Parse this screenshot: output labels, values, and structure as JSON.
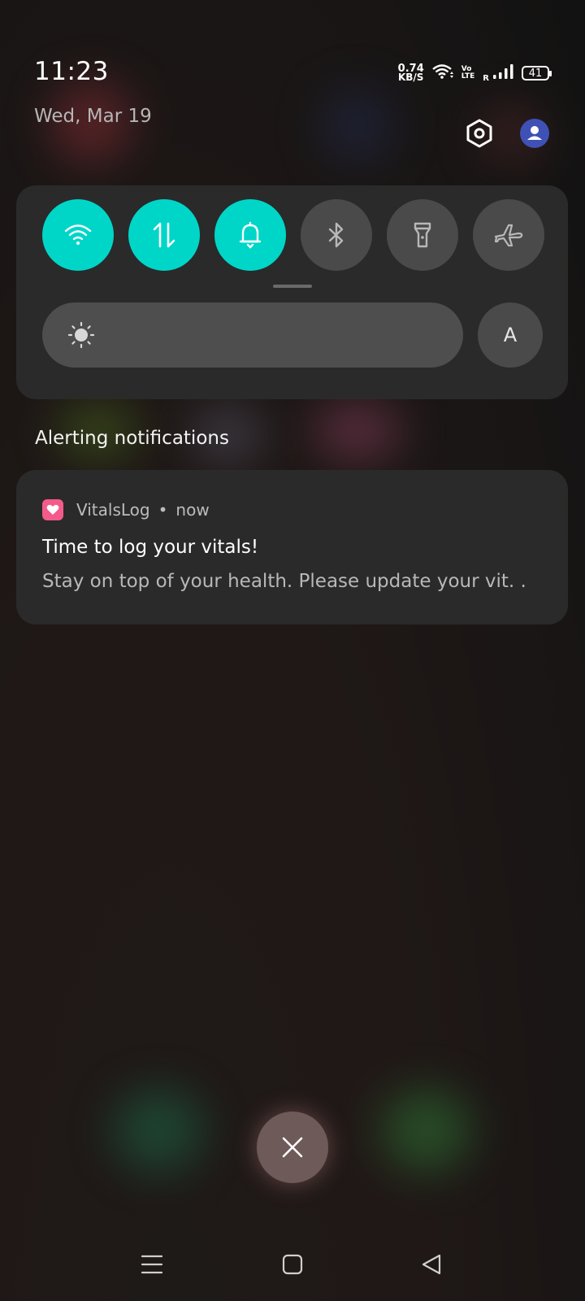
{
  "status_bar": {
    "time": "11:23",
    "net_speed_value": "0.74",
    "net_speed_unit": "KB/S",
    "volte_top": "Vo",
    "volte_bottom": "LTE",
    "roaming": "R",
    "battery": "41"
  },
  "header": {
    "date": "Wed, Mar 19",
    "icons": [
      "settings-icon",
      "account-icon"
    ]
  },
  "quick_settings": {
    "tiles": [
      {
        "name": "wifi",
        "active": true
      },
      {
        "name": "mobile-data",
        "active": true
      },
      {
        "name": "sound",
        "active": true
      },
      {
        "name": "bluetooth",
        "active": false
      },
      {
        "name": "flashlight",
        "active": false
      },
      {
        "name": "airplane-mode",
        "active": false
      }
    ],
    "auto_brightness_label": "A",
    "accent_color": "#00d6c8"
  },
  "notifications": {
    "section_title": "Alerting notifications",
    "items": [
      {
        "app_name": "VitalsLog",
        "separator": "•",
        "time": "now",
        "title": "Time to log your vitals!",
        "text": "Stay on top of your health. Please update your vit. ."
      }
    ]
  },
  "actions": {
    "clear_all": "close-icon"
  },
  "nav_bar": {
    "buttons": [
      "menu-icon",
      "home-icon",
      "back-icon"
    ]
  }
}
